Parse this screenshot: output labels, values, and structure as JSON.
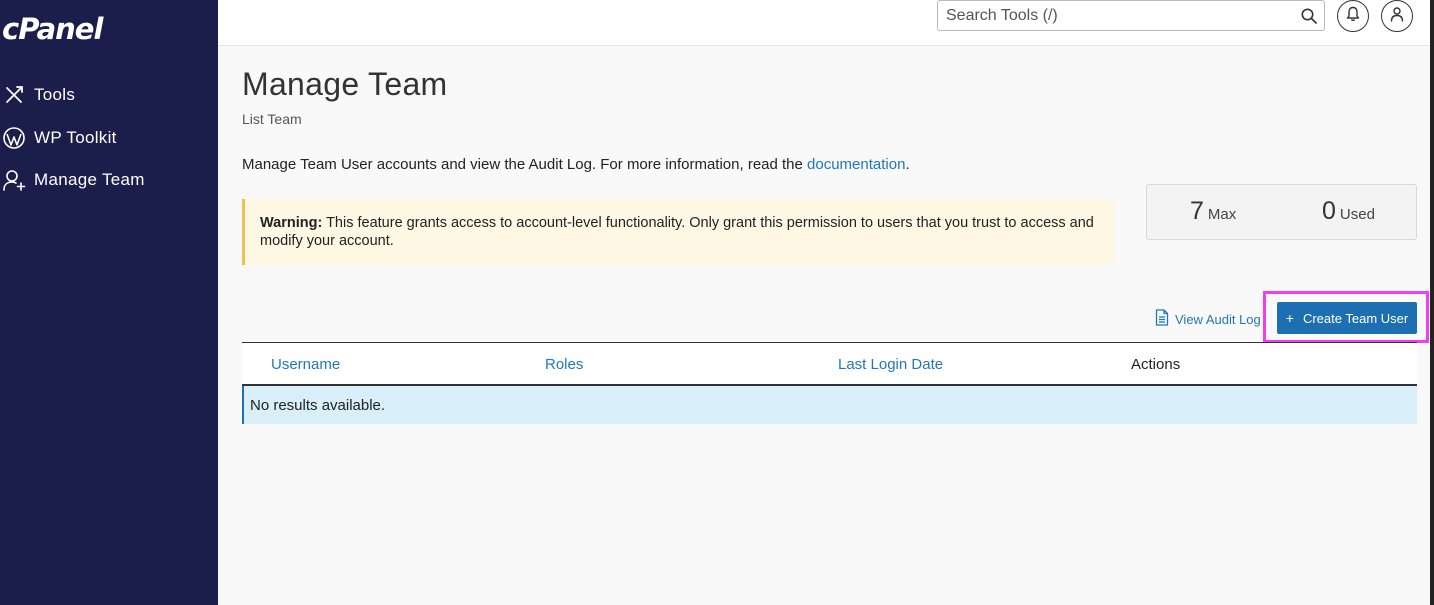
{
  "app": {
    "logo": "cPanel"
  },
  "sidebar": {
    "items": [
      {
        "label": "Tools",
        "icon": "tools-icon"
      },
      {
        "label": "WP Toolkit",
        "icon": "wordpress-icon"
      },
      {
        "label": "Manage Team",
        "icon": "manage-team-icon"
      }
    ]
  },
  "header": {
    "search_placeholder": "Search Tools (/)",
    "notifications_icon": "bell-icon",
    "user_icon": "user-icon"
  },
  "page": {
    "title": "Manage Team",
    "subtitle": "List Team",
    "intro_text": "Manage Team User accounts and view the Audit Log. For more information, read the ",
    "intro_link": "documentation",
    "intro_end": "."
  },
  "warning": {
    "label": "Warning:",
    "text": " This feature grants access to account-level functionality. Only grant this permission to users that you trust to access and modify your account."
  },
  "stats": {
    "max_value": "7",
    "max_label": "Max",
    "used_value": "0",
    "used_label": "Used"
  },
  "actions": {
    "audit_log": "View Audit Log",
    "create_user": "Create Team User"
  },
  "table": {
    "columns": [
      "Username",
      "Roles",
      "Last Login Date",
      "Actions"
    ],
    "empty_message": "No results available."
  },
  "colors": {
    "sidebar_bg": "#1b1e4b",
    "link": "#1e78b9",
    "primary_button": "#1d6fb1",
    "warning_bg": "#fdf7e4",
    "warning_border": "#f0c150",
    "highlight": "#ee40ee"
  }
}
